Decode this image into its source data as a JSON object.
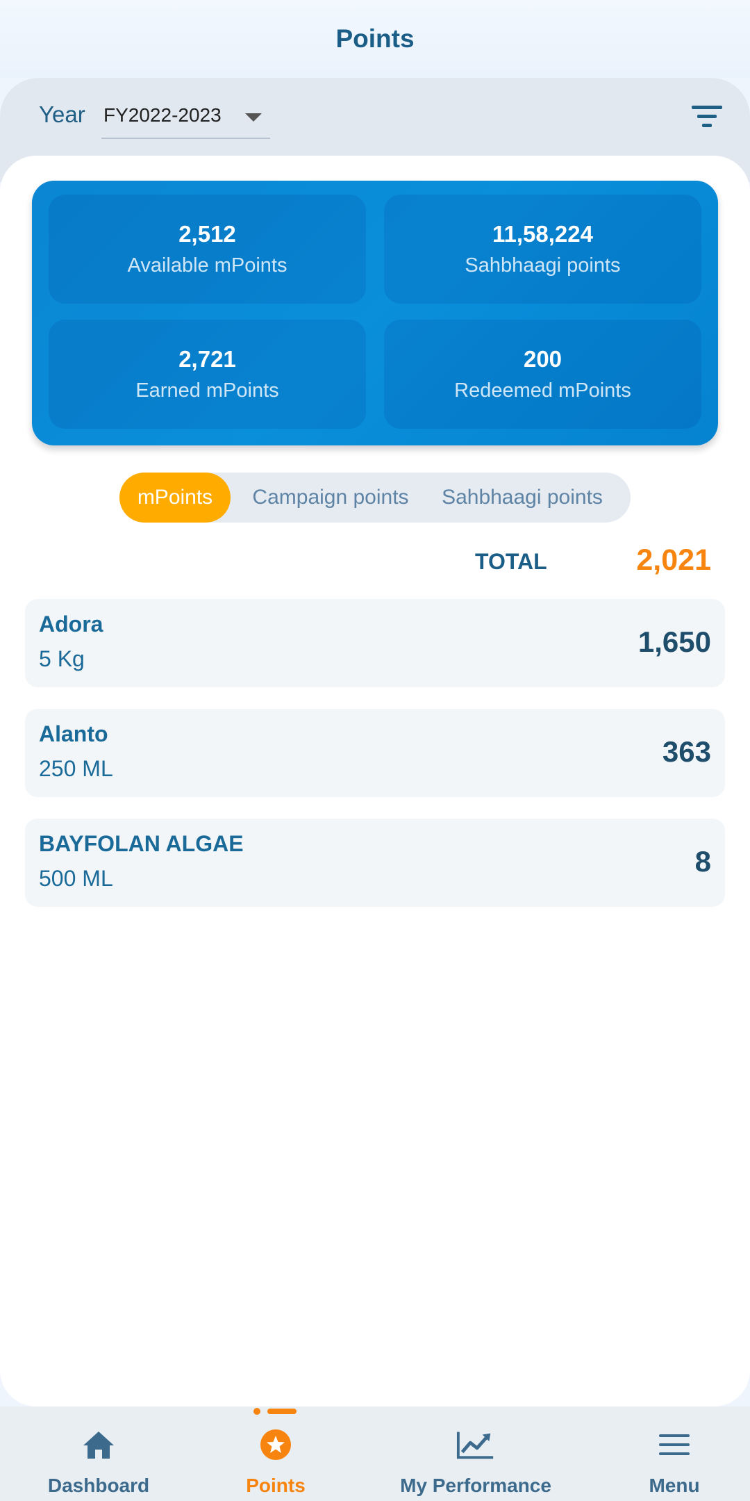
{
  "header": {
    "title": "Points"
  },
  "filter": {
    "year_label": "Year",
    "year_value": "FY2022-2023"
  },
  "summary": {
    "available": {
      "value": "2,512",
      "label": "Available mPoints"
    },
    "sahbhaagi": {
      "value": "11,58,224",
      "label": "Sahbhaagi points"
    },
    "earned": {
      "value": "2,721",
      "label": "Earned mPoints"
    },
    "redeemed": {
      "value": "200",
      "label": "Redeemed mPoints"
    }
  },
  "tabs": [
    {
      "label": "mPoints",
      "active": true
    },
    {
      "label": "Campaign points",
      "active": false
    },
    {
      "label": "Sahbhaagi points",
      "active": false
    }
  ],
  "total": {
    "label": "TOTAL",
    "value": "2,021"
  },
  "items": [
    {
      "name": "Adora",
      "size": "5 Kg",
      "points": "1,650"
    },
    {
      "name": "Alanto",
      "size": "250 ML",
      "points": "363"
    },
    {
      "name": "BAYFOLAN ALGAE",
      "size": "500 ML",
      "points": "8"
    }
  ],
  "nav": [
    {
      "label": "Dashboard",
      "icon": "home-icon",
      "active": false
    },
    {
      "label": "Points",
      "icon": "star-badge-icon",
      "active": true
    },
    {
      "label": "My Performance",
      "icon": "chart-line-icon",
      "active": false
    },
    {
      "label": "Menu",
      "icon": "menu-icon",
      "active": false
    }
  ],
  "colors": {
    "brand_blue": "#0a8fdb",
    "accent_orange": "#f7840e",
    "tab_active": "#ffab00",
    "text_primary": "#1a5d86"
  }
}
